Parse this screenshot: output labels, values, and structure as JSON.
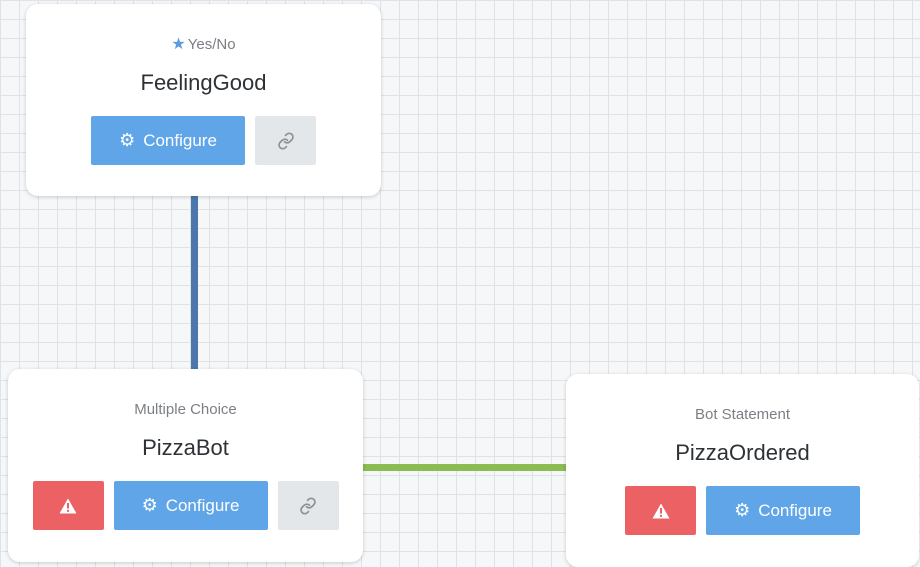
{
  "nodes": [
    {
      "id": "feelinggood",
      "type_label": "Yes/No",
      "type_icon": "star-icon",
      "title": "FeelingGood",
      "has_warning": false,
      "configure_label": "Configure",
      "has_link": true
    },
    {
      "id": "pizzabot",
      "type_label": "Multiple Choice",
      "title": "PizzaBot",
      "has_warning": true,
      "configure_label": "Configure",
      "has_link": true
    },
    {
      "id": "pizzaordered",
      "type_label": "Bot Statement",
      "title": "PizzaOrdered",
      "has_warning": true,
      "configure_label": "Configure",
      "has_link": false
    }
  ],
  "connections": [
    {
      "from": "FeelingGood",
      "to": "PizzaBot",
      "color": "#4c77ad"
    },
    {
      "from": "PizzaBot",
      "to": "PizzaOrdered",
      "color": "#8bbb53"
    }
  ],
  "colors": {
    "configure_button": "#5fa5e8",
    "warning_button": "#ec6164",
    "link_button": "#e4e7ea",
    "star_icon": "#5b9be0",
    "canvas_grid": "#dfe2e6"
  }
}
